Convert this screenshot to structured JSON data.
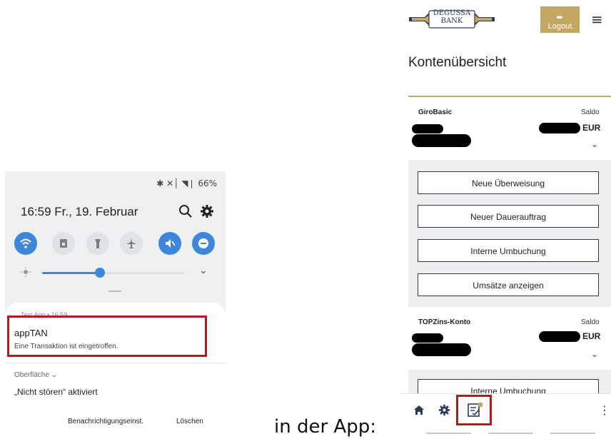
{
  "left_phone": {
    "status_icons": "✱ ✕│ ◥❘ 66%",
    "date_line": "16:59  Fr., 19. Februar",
    "notification": {
      "header": "Test App • 16:59",
      "title": "appTAN",
      "text": "Eine Transaktion ist eingetroffen."
    },
    "dnd": {
      "subheader": "Oberfläche ⌄",
      "title": "„Nicht stören“ aktiviert"
    },
    "buttons": {
      "settings": "Benachrichtigungseinst.",
      "clear": "Löschen"
    }
  },
  "caption": "in der App:",
  "app": {
    "logo_text": [
      "DEGUSSA",
      "BANK"
    ],
    "logout_label": "Logout",
    "menu_icon": "≡",
    "title": "Kontenübersicht",
    "accounts": [
      {
        "name": "GiroBasic",
        "saldo_label": "Saldo",
        "currency": "EUR"
      },
      {
        "name": "TOPZins-Konto",
        "saldo_label": "Saldo",
        "currency": "EUR"
      }
    ],
    "actions": [
      "Neue Überweisung",
      "Neuer Dauerauftrag",
      "Interne Umbuchung",
      "Umsätze anzeigen"
    ],
    "second_action_partial": "Interne Umbuchung",
    "chevron": "⌄",
    "nav_more": "⋮"
  },
  "colors": {
    "gold": "#c5a764",
    "navy": "#2b3a55",
    "highlight_red": "#b01c22",
    "toggle_blue": "#3d86d9"
  }
}
